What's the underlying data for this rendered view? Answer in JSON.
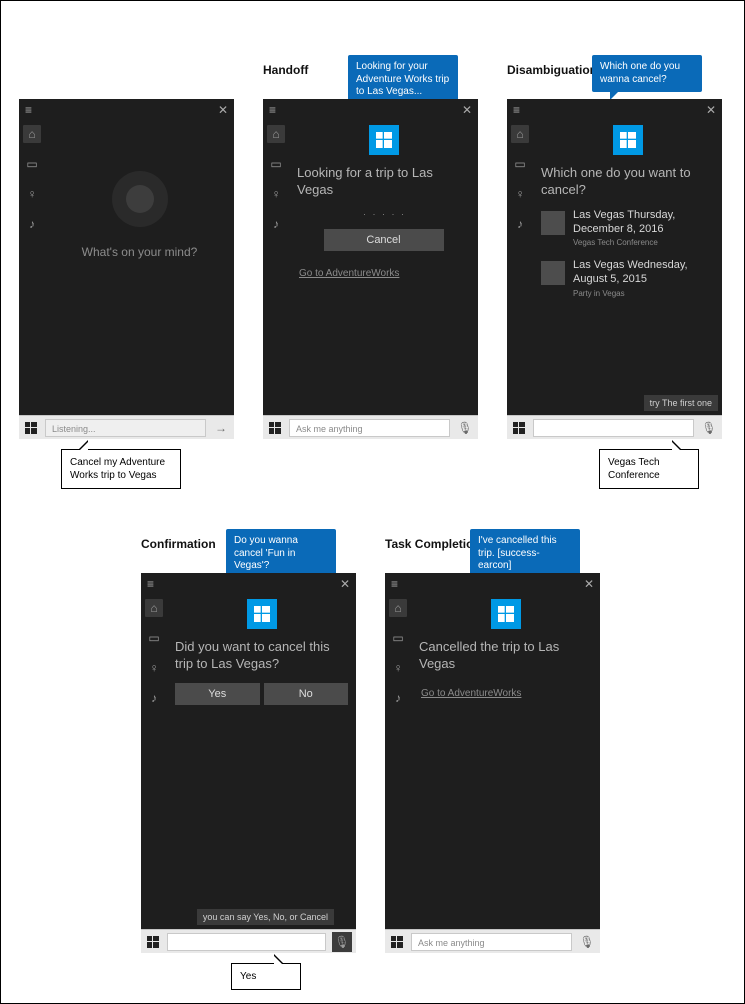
{
  "stages": {
    "initial": {
      "label": "",
      "prompt": "What's on your mind?",
      "searchbox": "Listening...",
      "user_utterance": "Cancel my Adventure Works trip to Vegas"
    },
    "handoff": {
      "label": "Handoff",
      "bubble": "Looking for your Adventure Works trip to Las Vegas...",
      "headline": "Looking for a trip to Las Vegas",
      "progress_dots": "· · · · ·",
      "cancel_btn": "Cancel",
      "link": "Go to AdventureWorks",
      "searchbox": "Ask me anything"
    },
    "disambiguation": {
      "label": "Disambiguation",
      "bubble": "Which one do you wanna cancel?",
      "headline": "Which one do you want to cancel?",
      "items": [
        {
          "title": "Las Vegas Thursday, December 8, 2016",
          "sub": "Vegas Tech Conference"
        },
        {
          "title": "Las Vegas Wednesday, August 5, 2015",
          "sub": "Party in Vegas"
        }
      ],
      "hint": "try The first one",
      "searchbox": "",
      "user_utterance": "Vegas Tech Conference"
    },
    "confirmation": {
      "label": "Confirmation",
      "bubble": "Do you wanna cancel 'Fun in Vegas'?",
      "headline": "Did you want to cancel this trip to Las Vegas?",
      "yes": "Yes",
      "no": "No",
      "hint": "you can say Yes, No, or Cancel",
      "searchbox": "",
      "user_utterance": "Yes"
    },
    "completion": {
      "label": "Task Completion",
      "bubble": "I've cancelled this trip. [success-earcon]",
      "headline": "Cancelled the trip to Las Vegas",
      "link": "Go to AdventureWorks",
      "searchbox": "Ask me anything"
    }
  },
  "icons": {
    "home": "⌂",
    "notebook": "▭",
    "bulb": "♀",
    "music": "♪",
    "mic": "🎤",
    "arrow": "→"
  }
}
